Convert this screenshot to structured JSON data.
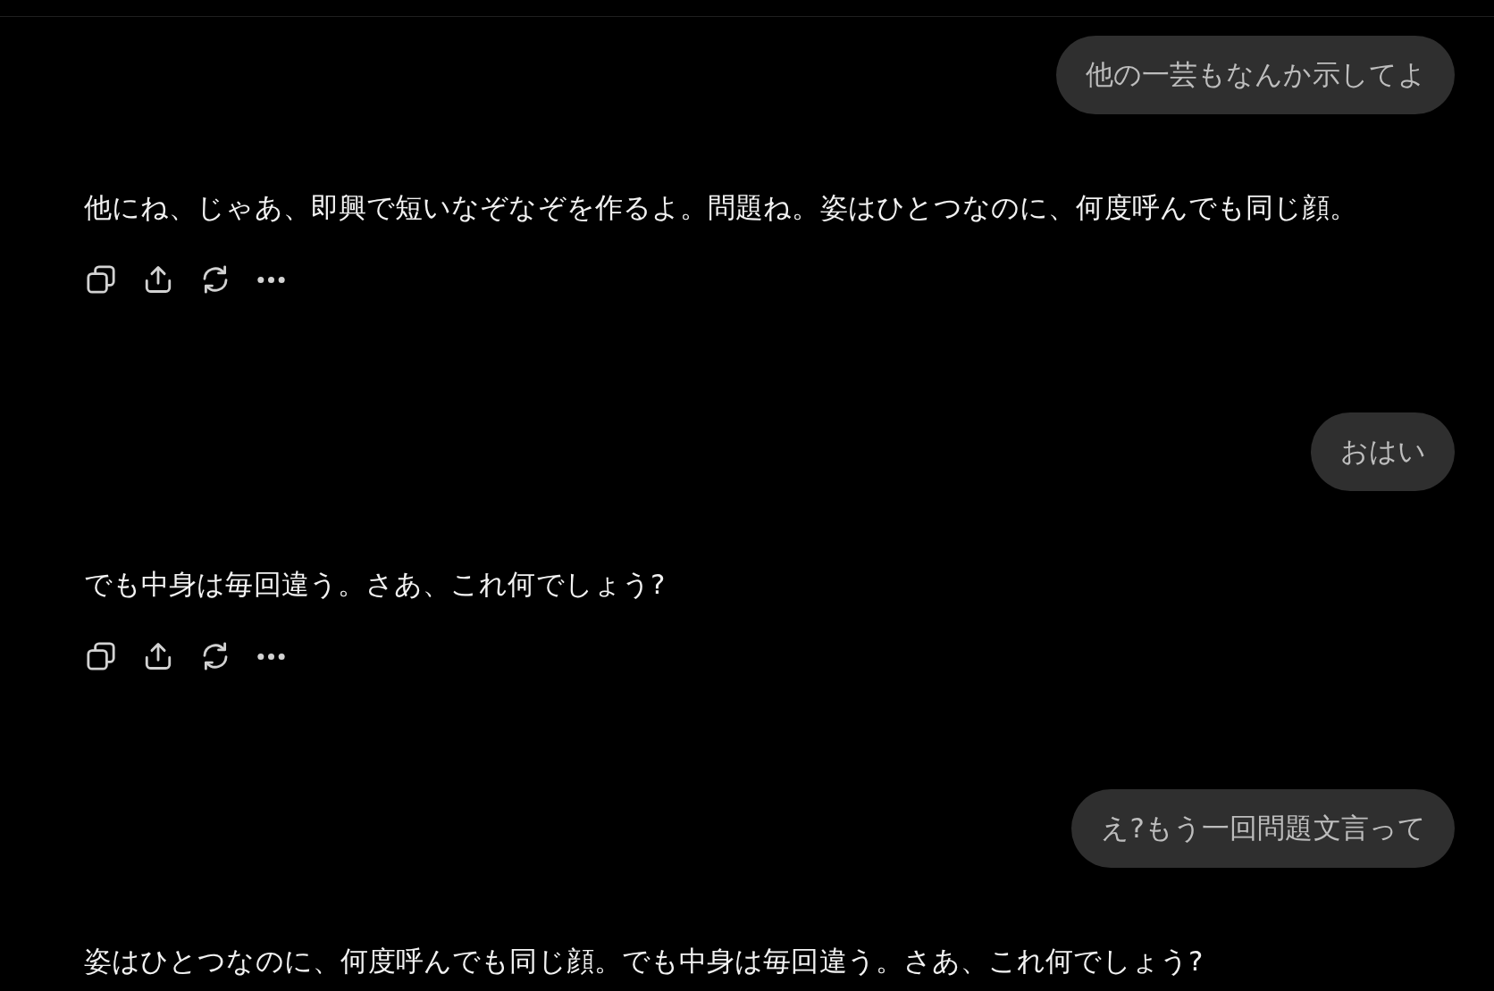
{
  "messages": [
    {
      "kind": "user",
      "text": "他の一芸もなんか示してよ"
    },
    {
      "kind": "assistant",
      "text": "他にね、じゃあ、即興で短いなぞなぞを作るよ。問題ね。姿はひとつなのに、何度呼んでも同じ顔。",
      "actions": true
    },
    {
      "kind": "user",
      "text": "おはい"
    },
    {
      "kind": "assistant",
      "text": "でも中身は毎回違う。さあ、これ何でしょう?",
      "actions": true
    },
    {
      "kind": "user",
      "text": "え?もう一回問題文言って"
    },
    {
      "kind": "assistant",
      "text": "姿はひとつなのに、何度呼んでも同じ顔。でも中身は毎回違う。さあ、これ何でしょう?"
    }
  ]
}
